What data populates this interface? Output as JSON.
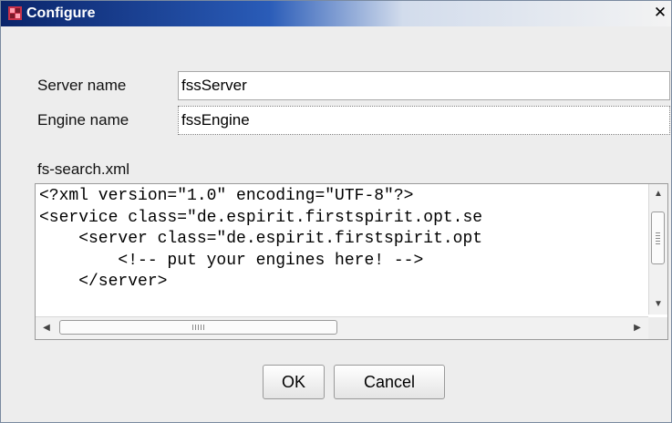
{
  "window": {
    "title": "Configure",
    "close_symbol": "✕"
  },
  "fields": {
    "server_label": "Server name",
    "server_value": "fssServer",
    "engine_label": "Engine name",
    "engine_value": "fssEngine"
  },
  "editor": {
    "label": "fs-search.xml",
    "lines": [
      "<?xml version=\"1.0\" encoding=\"UTF-8\"?>",
      "<service class=\"de.espirit.firstspirit.opt.se",
      "    <server class=\"de.espirit.firstspirit.opt",
      "        <!-- put your engines here! -->",
      "    </server>"
    ]
  },
  "buttons": {
    "ok_label": "OK",
    "cancel_label": "Cancel"
  },
  "icons": {
    "app": "app-icon",
    "close": "close-icon",
    "scroll_up": "arrow-up-icon",
    "scroll_down": "arrow-down-icon",
    "scroll_left": "arrow-left-icon",
    "scroll_right": "arrow-right-icon"
  },
  "colors": {
    "titlebar_start": "#0a246a",
    "titlebar_end": "#f3f3f3",
    "dialog_background": "#ededed"
  }
}
